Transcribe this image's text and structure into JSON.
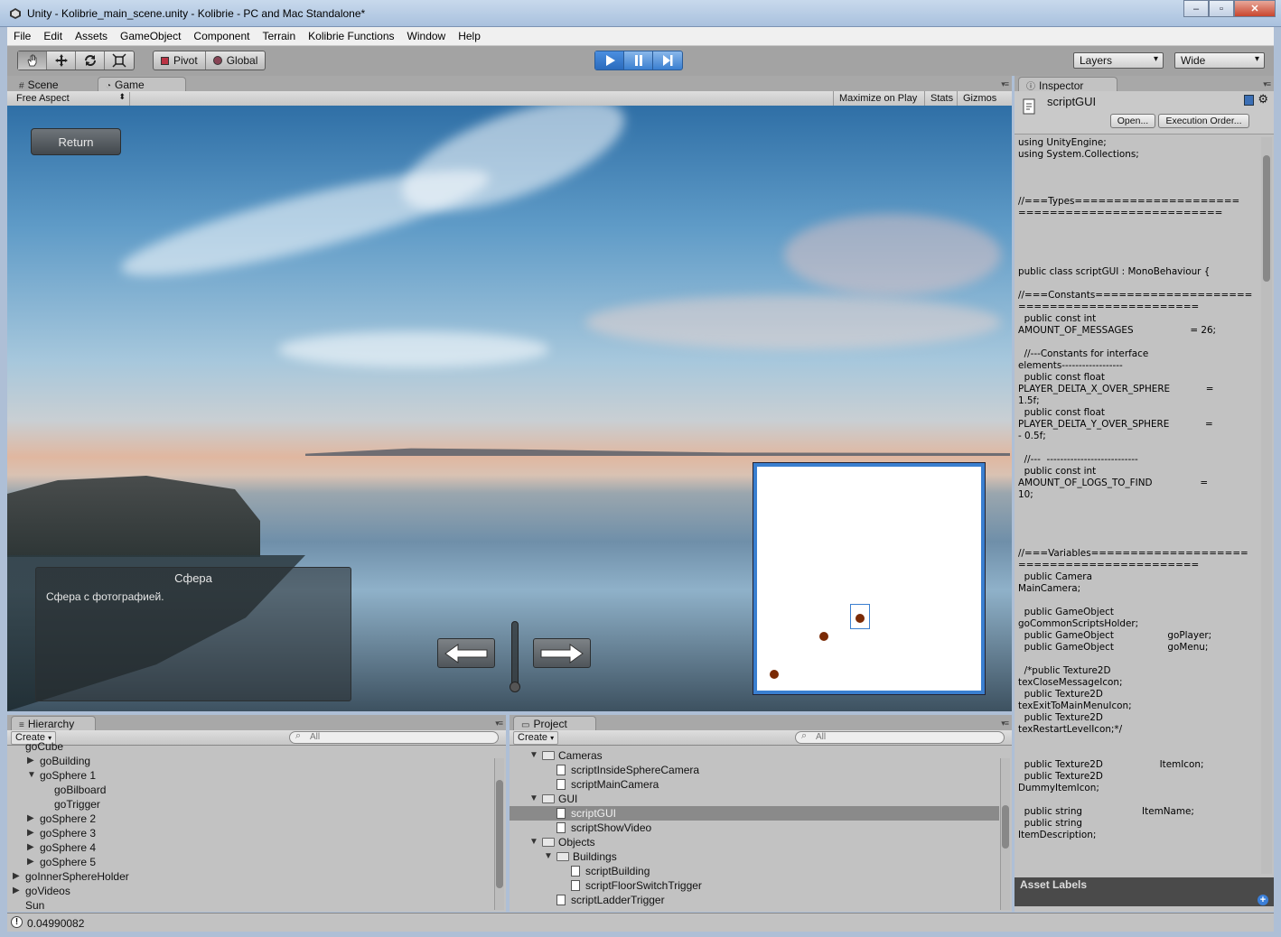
{
  "window": {
    "title": "Unity - Kolibrie_main_scene.unity - Kolibrie - PC and Mac Standalone*",
    "minimize": "–",
    "maximize": "▫",
    "close": "✕"
  },
  "menu": [
    "File",
    "Edit",
    "Assets",
    "GameObject",
    "Component",
    "Terrain",
    "Kolibrie Functions",
    "Window",
    "Help"
  ],
  "toolbar": {
    "pivot_label": "Pivot",
    "global_label": "Global",
    "layers_label": "Layers",
    "layout_label": "Wide"
  },
  "scene_tabs": {
    "scene": "Scene",
    "game": "Game"
  },
  "game_bar": {
    "aspect": "Free Aspect",
    "maximize": "Maximize on Play",
    "stats": "Stats",
    "gizmos": "Gizmos"
  },
  "game": {
    "return_label": "Return",
    "info_title": "Сфера",
    "info_text": "Сфера с фотографией.",
    "slider_value": 0.0
  },
  "hierarchy": {
    "tab": "Hierarchy",
    "create": "Create",
    "search_placeholder": "All",
    "items": [
      {
        "label": "goCube",
        "depth": 0,
        "arrow": ""
      },
      {
        "label": "goBuilding",
        "depth": 1,
        "arrow": "▶"
      },
      {
        "label": "goSphere 1",
        "depth": 1,
        "arrow": "▼"
      },
      {
        "label": "goBilboard",
        "depth": 2,
        "arrow": ""
      },
      {
        "label": "goTrigger",
        "depth": 2,
        "arrow": ""
      },
      {
        "label": "goSphere 2",
        "depth": 1,
        "arrow": "▶"
      },
      {
        "label": "goSphere 3",
        "depth": 1,
        "arrow": "▶"
      },
      {
        "label": "goSphere 4",
        "depth": 1,
        "arrow": "▶"
      },
      {
        "label": "goSphere 5",
        "depth": 1,
        "arrow": "▶"
      },
      {
        "label": "goInnerSphereHolder",
        "depth": 0,
        "arrow": "▶"
      },
      {
        "label": "goVideos",
        "depth": 0,
        "arrow": "▶"
      },
      {
        "label": "Sun",
        "depth": 0,
        "arrow": ""
      }
    ]
  },
  "project": {
    "tab": "Project",
    "create": "Create",
    "search_placeholder": "All",
    "items": [
      {
        "label": "Cameras",
        "depth": 1,
        "kind": "folder",
        "arrow": "▼"
      },
      {
        "label": "scriptInsideSphereCamera",
        "depth": 2,
        "kind": "script",
        "arrow": ""
      },
      {
        "label": "scriptMainCamera",
        "depth": 2,
        "kind": "script",
        "arrow": ""
      },
      {
        "label": "GUI",
        "depth": 1,
        "kind": "folder",
        "arrow": "▼"
      },
      {
        "label": "scriptGUI",
        "depth": 2,
        "kind": "script",
        "arrow": "",
        "selected": true
      },
      {
        "label": "scriptShowVideo",
        "depth": 2,
        "kind": "script",
        "arrow": ""
      },
      {
        "label": "Objects",
        "depth": 1,
        "kind": "folder",
        "arrow": "▼"
      },
      {
        "label": "Buildings",
        "depth": 2,
        "kind": "folder",
        "arrow": "▼"
      },
      {
        "label": "scriptBuilding",
        "depth": 3,
        "kind": "script",
        "arrow": ""
      },
      {
        "label": "scriptFloorSwitchTrigger",
        "depth": 3,
        "kind": "script",
        "arrow": ""
      },
      {
        "label": "scriptLadderTrigger",
        "depth": 2,
        "kind": "script",
        "arrow": ""
      }
    ]
  },
  "inspector": {
    "tab": "Inspector",
    "script_name": "scriptGUI",
    "open_label": "Open...",
    "execution_order_label": "Execution Order...",
    "code": "using UnityEngine;\nusing System.Collections;\n\n\n\n//===Types=====================\n==========================\n\n\n\n\npublic class scriptGUI : MonoBehaviour {\n\n//===Constants====================\n=======================\n  public const int\nAMOUNT_OF_MESSAGES                   = 26;\n\n  //---Constants for interface\nelements------------------\n  public const float\nPLAYER_DELTA_X_OVER_SPHERE            =\n1.5f;\n  public const float\nPLAYER_DELTA_Y_OVER_SPHERE            =\n- 0.5f;\n\n  //---  ---------------------------\n  public const int\nAMOUNT_OF_LOGS_TO_FIND                =\n10;\n\n\n\n\n//===Variables====================\n=======================\n  public Camera\nMainCamera;\n\n  public GameObject\ngoCommonScriptsHolder;\n  public GameObject                  goPlayer;\n  public GameObject                  goMenu;\n\n  /*public Texture2D\ntexCloseMessageIcon;\n  public Texture2D\ntexExitToMainMenuIcon;\n  public Texture2D\ntexRestartLevelIcon;*/\n\n\n  public Texture2D                   ItemIcon;\n  public Texture2D\nDummyItemIcon;\n\n  public string                    ItemName;\n  public string\nItemDescription;\n\n\n\n\n  /*scriptTimer\nscriptQuestTimer;",
    "asset_labels": "Asset Labels"
  },
  "status": {
    "message": "0.04990082"
  },
  "icons": {
    "hand": "hand-icon",
    "move": "move-icon",
    "rotate": "rotate-icon",
    "scale": "scale-icon",
    "play": "play-icon",
    "pause": "pause-icon",
    "step": "step-icon",
    "left_arrow": "left-arrow-icon",
    "right_arrow": "right-arrow-icon"
  },
  "colors": {
    "play_accent": "#3a7fd0",
    "minimap_dot": "#7a2a05"
  }
}
